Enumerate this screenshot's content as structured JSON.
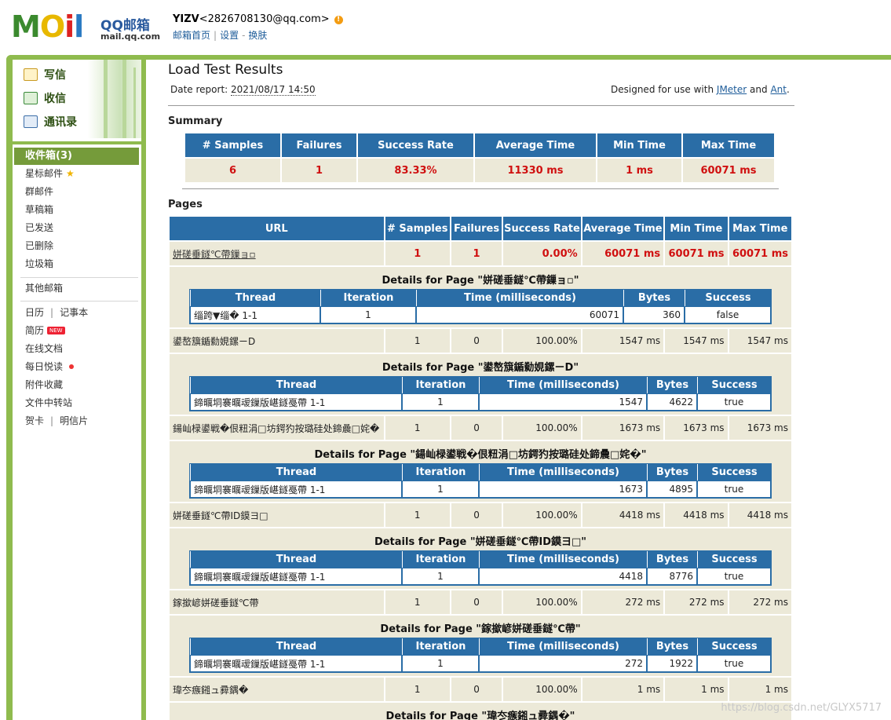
{
  "header": {
    "logo_text": "MOil",
    "logo_qq": "QQ邮箱",
    "logo_domain": "mail.qq.com",
    "nickname": "YIZV",
    "email": "<2826708130@qq.com>",
    "warn_glyph": "!",
    "links": [
      "邮箱首页",
      "设置",
      "换肤"
    ],
    "link_separators": [
      "|",
      "-"
    ]
  },
  "sidebar": {
    "quick": [
      {
        "label": "写信",
        "icon": "pencil-icon"
      },
      {
        "label": "收信",
        "icon": "inbox-download-icon"
      },
      {
        "label": "通讯录",
        "icon": "contacts-icon"
      }
    ],
    "inbox_label": "收件箱(3)",
    "folders": [
      "星标邮件",
      "群邮件",
      "草稿箱",
      "已发送",
      "已删除",
      "垃圾箱"
    ],
    "star_glyph": "★",
    "other_label": "其他邮箱",
    "tools": {
      "calendar": "日历",
      "notepad": "记事本",
      "resume": "简历",
      "new_badge": "NEW",
      "docs": "在线文档",
      "daily": "每日悦读",
      "favorites": "附件收藏",
      "transfer": "文件中转站",
      "cards": "贺卡",
      "postcards": "明信片",
      "sep": "|"
    }
  },
  "report": {
    "title": "Load Test Results",
    "date_label": "Date report:",
    "date_value": "2021/08/17 14:50",
    "designed_prefix": "Designed for use with",
    "jmeter": "JMeter",
    "and": "and",
    "ant": "Ant",
    "period": ".",
    "summary_title": "Summary",
    "summary_headers": [
      "# Samples",
      "Failures",
      "Success Rate",
      "Average Time",
      "Min Time",
      "Max Time"
    ],
    "summary_values": [
      "6",
      "1",
      "83.33%",
      "11330 ms",
      "1 ms",
      "60071 ms"
    ],
    "pages_title": "Pages",
    "pages_headers": [
      "URL",
      "# Samples",
      "Failures",
      "Success Rate",
      "Average Time",
      "Min Time",
      "Max Time"
    ],
    "detail_headers": [
      "Thread",
      "Iteration",
      "Time (milliseconds)",
      "Bytes",
      "Success"
    ],
    "pages": [
      {
        "url": "姘磋垂鐩℃帶鏁ョ▫",
        "samples": "1",
        "failures": "1",
        "rate": "0.00%",
        "avg": "60071 ms",
        "min": "60071 ms",
        "max": "60071 ms",
        "details_title": "Details for Page \"姘磋垂鐩℃帶鏁ョ▫\"",
        "detail": {
          "thread": "缁跨▼缁� 1-1",
          "iteration": "1",
          "time": "60071",
          "bytes": "360",
          "success": "false"
        }
      },
      {
        "url": "鍙嶅簱鍎勬娊鏍ㄧD",
        "samples": "1",
        "failures": "0",
        "rate": "100.00%",
        "avg": "1547 ms",
        "min": "1547 ms",
        "max": "1547 ms",
        "details_title": "Details for Page \"鍙嶅簱鍎勬娊鏍ㄧD\"",
        "detail": {
          "thread": "鍗曞垌褰曞叆鏁版嵁鐩戞帶 1-1",
          "iteration": "1",
          "time": "1547",
          "bytes": "4622",
          "success": "true"
        }
      },
      {
        "url": "鍚屾椂鍙戦�佷粈涓□坊鍔犳按璐硅处鍗曟□姹�",
        "samples": "1",
        "failures": "0",
        "rate": "100.00%",
        "avg": "1673 ms",
        "min": "1673 ms",
        "max": "1673 ms",
        "details_title": "Details for Page \"鍚屾椂鍙戦�佷粈涓□坊鍔犳按璐硅处鍗曟□姹�\"",
        "detail": {
          "thread": "鍗曞垌褰曞叆鏁版嵁鐩戞帶 1-1",
          "iteration": "1",
          "time": "1673",
          "bytes": "4895",
          "success": "true"
        }
      },
      {
        "url": "姘磋垂鐩℃帶ID鏌ヨ□",
        "samples": "1",
        "failures": "0",
        "rate": "100.00%",
        "avg": "4418 ms",
        "min": "4418 ms",
        "max": "4418 ms",
        "details_title": "Details for Page \"姘磋垂鐩℃帶ID鏌ヨ□\"",
        "detail": {
          "thread": "鍗曞垌褰曞叆鏁版嵁鐩戞帶 1-1",
          "iteration": "1",
          "time": "4418",
          "bytes": "8776",
          "success": "true"
        }
      },
      {
        "url": "鎵撳嵃姘磋垂鐩℃帶",
        "samples": "1",
        "failures": "0",
        "rate": "100.00%",
        "avg": "272 ms",
        "min": "272 ms",
        "max": "272 ms",
        "details_title": "Details for Page \"鎵撳嵃姘磋垂鐩℃帶\"",
        "detail": {
          "thread": "鍗曞垌褰曞叆鏁版嵁鐩戞帶 1-1",
          "iteration": "1",
          "time": "272",
          "bytes": "1922",
          "success": "true"
        }
      },
      {
        "url": "瑋冭瘯鎺ュ彛鍝�",
        "samples": "1",
        "failures": "0",
        "rate": "100.00%",
        "avg": "1 ms",
        "min": "1 ms",
        "max": "1 ms",
        "details_title": "Details for Page \"瑋冭瘯鎺ュ彛鍝�\""
      }
    ]
  },
  "watermark": "https://blog.csdn.net/GLYX5717",
  "colors": {
    "frame_green": "#8fbb4e",
    "inbox_green": "#759b3a",
    "header_blue": "#2a6da6",
    "row_beige": "#ece9d8",
    "fail_red": "#d01010"
  }
}
